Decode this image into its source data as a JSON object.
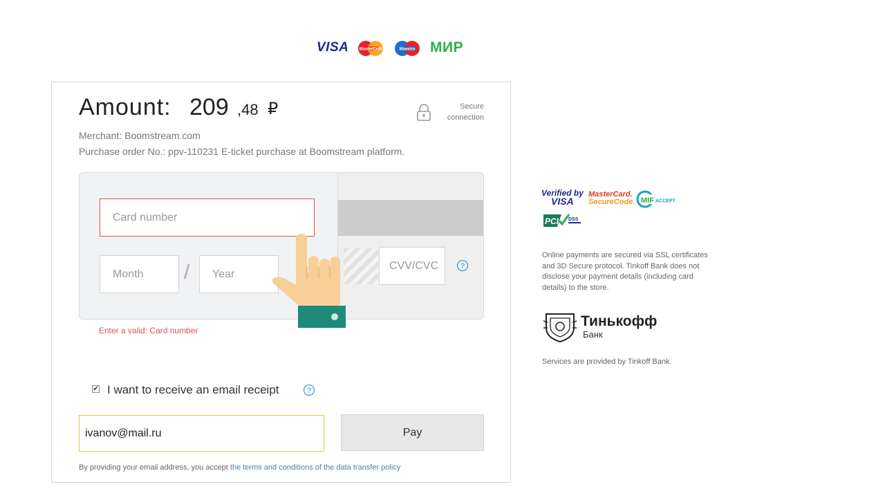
{
  "payment_logos": {
    "visa": "VISA",
    "mastercard": "MasterCard",
    "maestro": "Maestro",
    "mir": "МИР"
  },
  "header": {
    "amount_label": "Amount:",
    "amount_integer": "209",
    "amount_decimal": ",48",
    "currency_symbol": "₽",
    "secure_line1": "Secure",
    "secure_line2": "connection",
    "merchant": "Merchant: Boomstream.com",
    "order": "Purchase order No.: ppv-110231 E-ticket purchase at Boomstream platform."
  },
  "card_form": {
    "card_number_placeholder": "Card number",
    "month_placeholder": "Month",
    "year_placeholder": "Year",
    "separator": "/",
    "cvv_placeholder": "CVV/CVC",
    "error": "Enter a valid: Card number"
  },
  "receipt": {
    "checked": true,
    "label": "I want to receive an email receipt",
    "email_value": "ivanov@mail.ru",
    "pay_label": "Pay",
    "consent_prefix": "By providing your email address, you accept ",
    "consent_link": "the terms and conditions of the data transfer policy"
  },
  "security_badges": {
    "vbv_line1": "Verified by",
    "vbv_line2": "VISA",
    "mc_line1": "MasterCard.",
    "mc_line2": "SecureCode.",
    "mir_accept": "ACCEPT",
    "pci": "PCI",
    "dss": "DSS"
  },
  "info": {
    "text": "Online payments are secured via SSL certificates and 3D Secure protocol. Tinkoff Bank does not disclose your payment details (including card details) to the store.",
    "bank_name": "Тинькофф",
    "bank_sub": "Банк",
    "services": "Services are provided by Tinkoff Bank."
  },
  "colors": {
    "error": "#e05050",
    "link": "#4a7fb5",
    "email_border": "#e8c44a",
    "help_icon": "#3a9ad9",
    "hand_sleeve": "#1f8a78"
  }
}
